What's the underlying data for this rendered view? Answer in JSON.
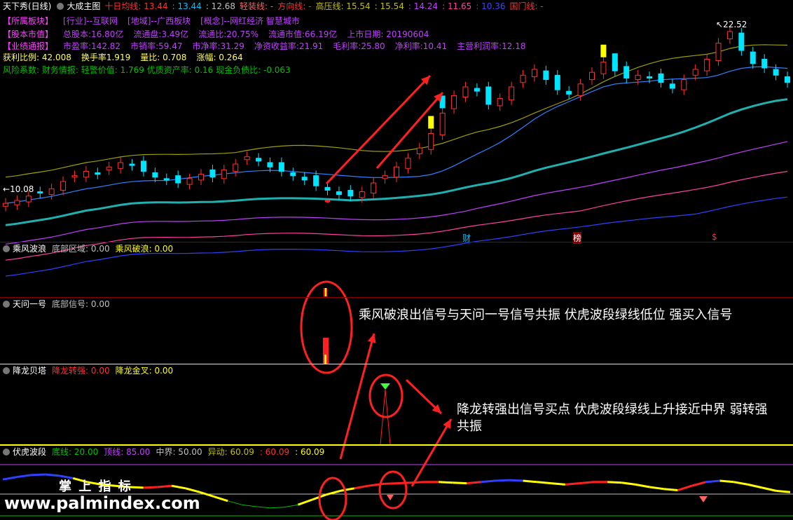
{
  "header": {
    "items": [
      {
        "text": "天下秀(日线)",
        "color": "#ffffff"
      },
      {
        "text": "大成主图",
        "color": "#ffffff"
      },
      {
        "text": "十日均线: 13.44",
        "color": "#ff3030"
      },
      {
        "text": ": 13.44",
        "color": "#00c0ff"
      },
      {
        "text": ": 12.68",
        "color": "#c0c0c0"
      },
      {
        "text": "轻装线: -",
        "color": "#ff6060"
      },
      {
        "text": "方向线: -",
        "color": "#ff3030"
      },
      {
        "text": "高压线: 15.54",
        "color": "#c0c000"
      },
      {
        "text": ": 15.54",
        "color": "#c0c000"
      },
      {
        "text": ": 14.24",
        "color": "#c040ff"
      },
      {
        "text": ": 11.65",
        "color": "#ff40a0"
      },
      {
        "text": ": 10.36",
        "color": "#4040ff"
      },
      {
        "text": "国门线: -",
        "color": "#ff3030"
      }
    ]
  },
  "info": {
    "row1": [
      "【所属板块】",
      "[行业]--互联网",
      "[地域]--广西板块",
      "[概念]--网红经济 智慧城市"
    ],
    "row2": [
      "【股本市值】",
      "总股本:16.80亿",
      "流通盘:3.49亿",
      "流通比:20.75%",
      "流通市值:66.19亿",
      "上市日期: 20190604"
    ],
    "row3": [
      "【业绩通报】",
      "市盈率:142.82",
      "市销率:59.47",
      "市净率:31.29",
      "净资收益率:21.91",
      "毛利率:25.80",
      "净利率:10.41",
      "主营利润率:12.18"
    ],
    "row4": [
      "获利比例: 42.008",
      "换手率1.919",
      "量比: 0.708",
      "涨幅: 0.264"
    ],
    "row5": "风险系数: 财务情报: 轻警价值: 1.769 优质资产率: 0.16 现金负债比: -0.063"
  },
  "price_labels": {
    "high": "22.52",
    "low": "10.08"
  },
  "event_marks": [
    "财",
    "榜",
    "$"
  ],
  "panels": {
    "p1": {
      "name": "乘风波浪",
      "items": [
        {
          "text": "底部区域: 0.00",
          "color": "#c0c0c0"
        },
        {
          "text": "乘风破浪: 0.00",
          "color": "#ffff00"
        }
      ]
    },
    "p2": {
      "name": "天问一号",
      "items": [
        {
          "text": "底部信号: 0.00",
          "color": "#c0c0c0"
        }
      ]
    },
    "p3": {
      "name": "降龙贝塔",
      "items": [
        {
          "text": "降龙转强: 0.00",
          "color": "#ff3030"
        },
        {
          "text": "降龙金叉: 0.00",
          "color": "#ffff00"
        }
      ]
    },
    "p4": {
      "name": "伏虎波段",
      "items": [
        {
          "text": "底线: 20.00",
          "color": "#00c000"
        },
        {
          "text": "顶线: 85.00",
          "color": "#c040ff"
        },
        {
          "text": "中界: 50.00",
          "color": "#c0c0c0"
        },
        {
          "text": "异动: 60.09",
          "color": "#c0c000"
        },
        {
          "text": ": 60.09",
          "color": "#ff3030"
        },
        {
          "text": ": 60.09",
          "color": "#ffff00"
        }
      ]
    }
  },
  "annotations": {
    "a1": "乘风破浪出信号与天问一号信号共振 伏虎波段绿线低位 强买入信号",
    "a2_line1": "降龙转强出信号买点 伏虎波段绿线上升接近中界 弱转强",
    "a2_line2": "共振"
  },
  "watermark": {
    "cn": "掌 上 指 标",
    "url": "www.palmindex.com"
  },
  "colors": {
    "up": "#ff3030",
    "down": "#00e5ff",
    "bg": "#000000",
    "annotation": "#ff2020"
  },
  "chart_data": {
    "type": "candlestick",
    "price_range": [
      8.0,
      23.5
    ],
    "close_approx": [
      10.4,
      10.6,
      10.9,
      11.1,
      11.4,
      11.9,
      12.3,
      12.6,
      12.4,
      12.9,
      13.2,
      13.0,
      12.6,
      12.2,
      12.0,
      11.8,
      12.1,
      12.4,
      12.2,
      12.7,
      13.1,
      13.6,
      13.3,
      12.9,
      12.6,
      12.3,
      12.0,
      11.6,
      11.3,
      11.0,
      10.9,
      11.2,
      11.8,
      12.3,
      12.9,
      13.5,
      14.2,
      15.2,
      16.6,
      17.8,
      18.4,
      18.1,
      17.2,
      17.6,
      18.4,
      19.2,
      19.6,
      18.9,
      18.2,
      17.9,
      18.6,
      19.4,
      20.1,
      19.5,
      19.0,
      19.2,
      19.0,
      18.7,
      18.3,
      18.9,
      19.6,
      20.3,
      21.4,
      22.2,
      20.9,
      20.0,
      19.7,
      19.2,
      18.7
    ],
    "bodong_line": [
      62,
      66,
      69,
      70,
      68,
      64,
      58,
      54,
      52,
      50,
      49,
      50,
      52,
      48,
      42,
      35,
      28,
      22,
      19,
      17,
      18,
      22,
      30,
      38,
      44,
      48,
      52,
      55,
      56,
      57,
      58,
      58,
      57,
      56,
      58,
      60,
      61,
      60,
      58,
      56,
      54,
      56,
      58,
      58,
      57,
      54,
      50,
      47,
      45,
      52,
      58,
      60,
      58,
      54,
      49,
      44,
      42
    ]
  }
}
